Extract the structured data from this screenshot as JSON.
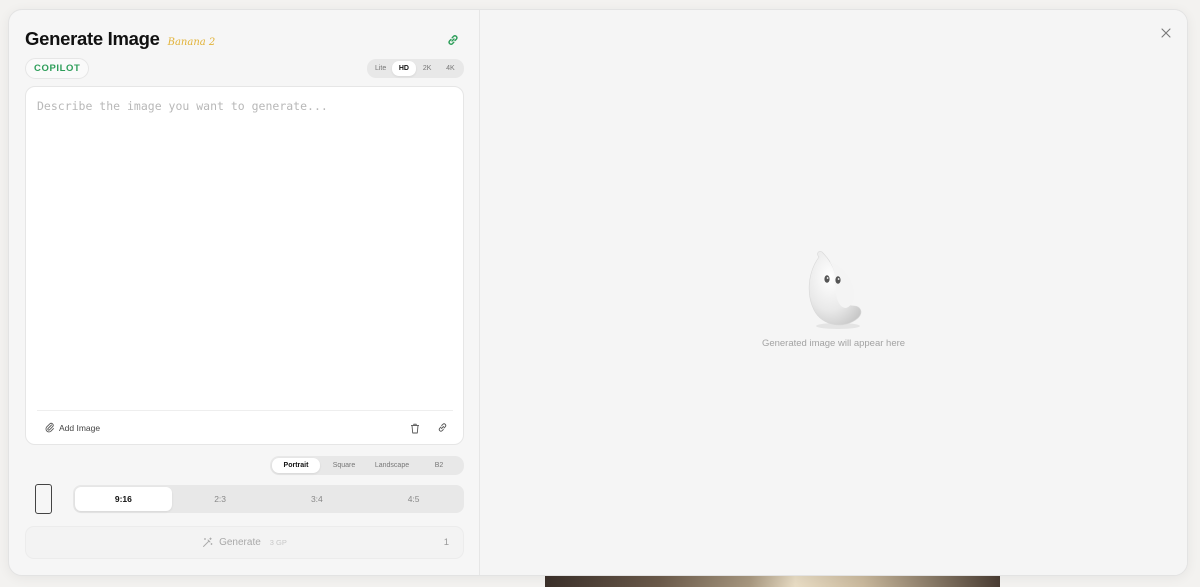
{
  "app": {
    "title": "Generate Image",
    "model_name": "Banana 2",
    "link_icon": "link-icon",
    "close_icon": "close-icon"
  },
  "copilot": {
    "label": "COPILOT",
    "color": "#2e9e5a"
  },
  "quality": {
    "options": [
      "Lite",
      "HD",
      "2K",
      "4K"
    ],
    "selected": "HD"
  },
  "prompt": {
    "value": "",
    "placeholder": "Describe the image you want to generate..."
  },
  "prompt_toolbar": {
    "add_image_label": "Add Image",
    "add_image_icon": "paperclip-icon",
    "clear_icon": "trash-icon",
    "copilot_icon": "sparkle-link-icon"
  },
  "orientation": {
    "options": [
      "Portrait",
      "Square",
      "Landscape",
      "B2"
    ],
    "selected": "Portrait"
  },
  "aspect_ratio": {
    "icon": "phone-portrait-icon",
    "options": [
      "9:16",
      "2:3",
      "3:4",
      "4:5"
    ],
    "selected": "9:16"
  },
  "generate": {
    "label": "Generate",
    "cost": "3 GP",
    "count": "1",
    "icon": "magic-wand-icon"
  },
  "preview": {
    "empty_text": "Generated image will appear here",
    "mascot_icon": "banana-mascot-icon"
  },
  "colors": {
    "accent_green": "#2e9e5a",
    "model_tag": "#e2b33a"
  }
}
